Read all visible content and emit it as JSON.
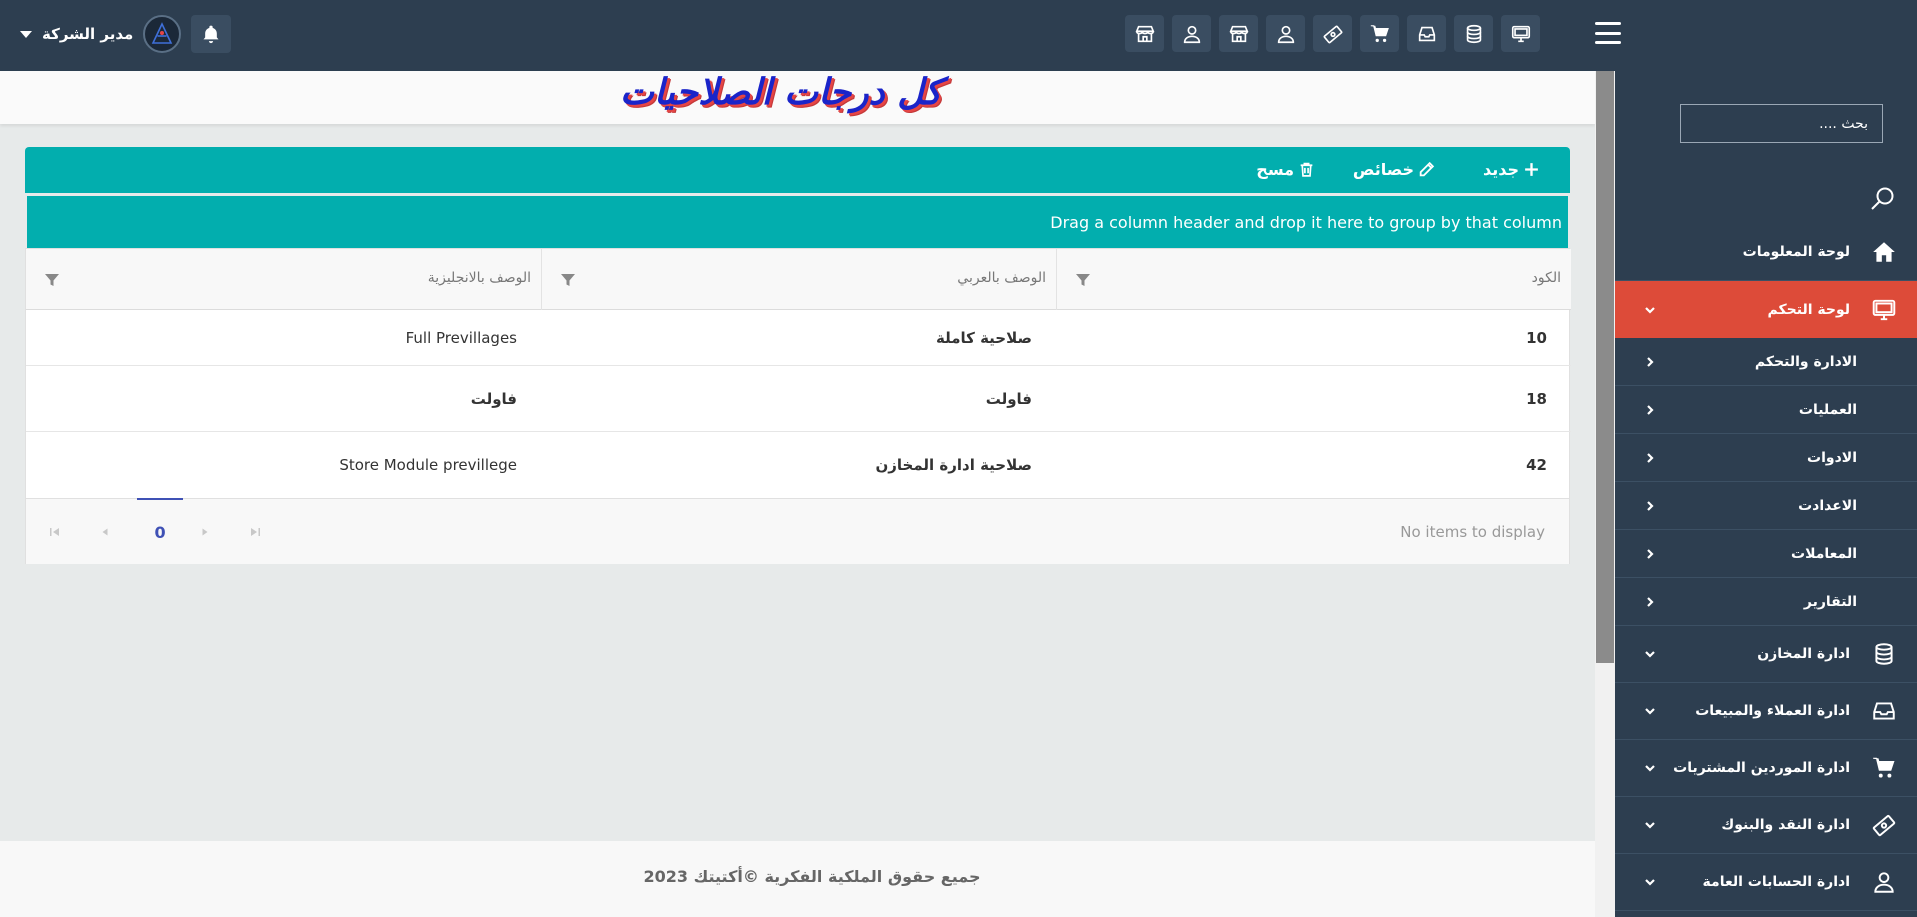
{
  "topbar": {
    "icons": [
      "monitor-icon",
      "database-icon",
      "inbox-icon",
      "cart-icon",
      "money-icon",
      "user-icon",
      "store-icon",
      "user-icon",
      "store-icon"
    ],
    "user_name": "مدير الشركة"
  },
  "sidebar": {
    "search_placeholder": "بحث ....",
    "items": [
      {
        "label": "لوحة المعلومات",
        "icon": "home-icon"
      },
      {
        "label": "لوحة التحكم",
        "icon": "monitor-icon",
        "active": true
      },
      {
        "label": "الادارة والتحكم"
      },
      {
        "label": "العمليات"
      },
      {
        "label": "الادوات"
      },
      {
        "label": "الاعدادت"
      },
      {
        "label": "المعاملات"
      },
      {
        "label": "التقارير"
      },
      {
        "label": "ادارة المخازن",
        "icon": "database-icon"
      },
      {
        "label": "ادارة العملاء والمبيعات",
        "icon": "inbox-icon"
      },
      {
        "label": "ادارة الموردين المشتريات",
        "icon": "cart-icon"
      },
      {
        "label": "ادارة النقد والبنوك",
        "icon": "money-icon"
      },
      {
        "label": "ادارة الحسابات العامة",
        "icon": "user-icon"
      }
    ]
  },
  "page": {
    "title": "كل درجات الصلاحيات"
  },
  "toolbar": {
    "new_label": "جديد",
    "edit_label": "خصائص",
    "delete_label": "مسح"
  },
  "grid": {
    "group_hint": "Drag a column header and drop it here to group by that column",
    "columns": [
      "الكود",
      "الوصف بالعربي",
      "الوصف بالانجليزية"
    ],
    "rows": [
      {
        "code": "10",
        "ar": "صلاحية كاملة",
        "en": "Full Previllages"
      },
      {
        "code": "18",
        "ar": "فاولت",
        "en": "فاولت"
      },
      {
        "code": "42",
        "ar": "صلاحية ادارة المخازن",
        "en": "Store Module previllege"
      }
    ],
    "pager": {
      "page": "0",
      "info": "No items to display"
    }
  },
  "footer": {
    "text": "جميع حقوق الملكية الفكرية ©أكتيتك 2023"
  },
  "colors": {
    "topbar": "#2d3e50",
    "accent_teal": "#02aeae",
    "active_menu": "#dd4b39",
    "title_blue": "#1a24c9"
  }
}
